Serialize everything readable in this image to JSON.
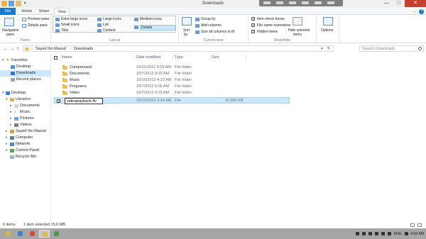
{
  "window": {
    "title": "Downloads",
    "minimize": "—",
    "maximize": "□",
    "close": "✕"
  },
  "ribbon_tabs": {
    "file": "File",
    "home": "Home",
    "share": "Share",
    "view": "View"
  },
  "ribbon": {
    "panes": {
      "navigation_pane": "Navigation",
      "navigation_pane_2": "pane",
      "preview_pane": "Preview pane",
      "details_pane": "Details pane",
      "group_label": "Panes"
    },
    "layout": {
      "extra_large_icons": "Extra large icons",
      "large_icons": "Large icons",
      "medium_icons": "Medium icons",
      "small_icons": "Small icons",
      "list": "List",
      "details": "Details",
      "tiles": "Tiles",
      "content": "Content",
      "group_label": "Layout"
    },
    "current_view": {
      "sort_by": "Sort",
      "sort_by_2": "by",
      "group_by": "Group by",
      "add_columns": "Add columns",
      "size_all_columns": "Size all columns to fit",
      "group_label": "Current view"
    },
    "show_hide": {
      "item_check_boxes": "Item check boxes",
      "file_name_extensions": "File name extensions",
      "hidden_items": "Hidden items",
      "hide_selected": "Hide selected",
      "hide_selected_2": "items",
      "options": "Options",
      "group_label": "Show/hide",
      "item_check_boxes_checked": true,
      "file_name_extensions_checked": true,
      "hidden_items_checked": true
    }
  },
  "address": {
    "back": "←",
    "forward": "→",
    "up": "↑",
    "path": [
      "Sayed Ibn Masud",
      "Downloads"
    ],
    "refresh": "↻",
    "search_placeholder": "Search Downloads"
  },
  "nav": {
    "favorites": "Favorites",
    "desktop": "Desktop",
    "downloads": "Downloads",
    "recent_places": "Recent places",
    "desktop_root": "Desktop",
    "libraries": "Libraries",
    "documents": "Documents",
    "music": "Music",
    "pictures": "Pictures",
    "videos": "Videos",
    "user": "Sayed Ibn Masud",
    "computer": "Computer",
    "network": "Network",
    "control_panel": "Control Panel",
    "recycle_bin": "Recycle Bin"
  },
  "columns": {
    "name": "Name",
    "date_modified": "Date modified",
    "type": "Type",
    "size": "Size"
  },
  "files": [
    {
      "name": "Compressed",
      "date": "10/11/2012 9:29 AM",
      "type": "File folder",
      "size": ""
    },
    {
      "name": "Documents",
      "date": "10/7/2012 9:29 AM",
      "type": "File folder",
      "size": ""
    },
    {
      "name": "Music",
      "date": "10/10/2012 4:33 AM",
      "type": "File folder",
      "size": ""
    },
    {
      "name": "Programs",
      "date": "10/7/2012 9:06 AM",
      "type": "File folder",
      "size": ""
    },
    {
      "name": "Video",
      "date": "10/7/2012 9:29 AM",
      "type": "File folder",
      "size": ""
    },
    {
      "name": "videoplayback.flv",
      "date": "10/12/2012 4:34 AM",
      "type": "File",
      "size": "15,990 KB"
    }
  ],
  "status": {
    "items": "6 items",
    "selected": "1 item selected  15.6 MB"
  },
  "taskbar": {
    "language": "ENG",
    "time": "4:32 AM"
  },
  "colors": {
    "file_tab": "#1979ca",
    "selection": "#cce8ff",
    "folder": "#e8c25e",
    "taskbar": "#a6a6a6",
    "close_button": "#c7402d"
  }
}
